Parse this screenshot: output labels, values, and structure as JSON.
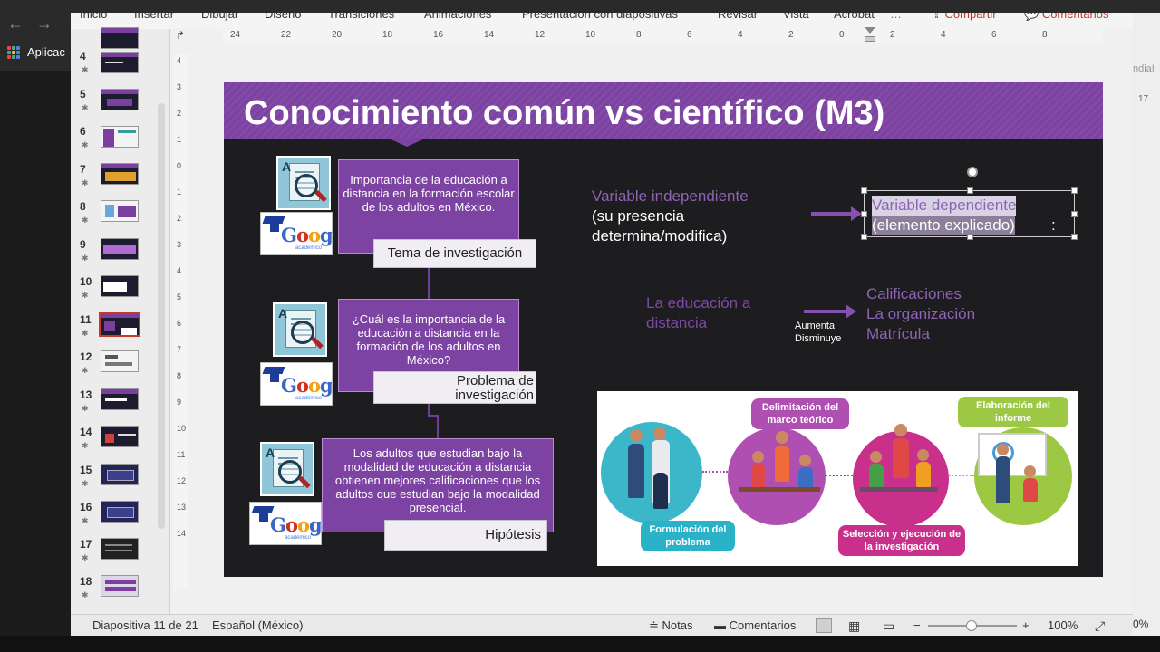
{
  "menubar": {
    "items": [
      "Inicio",
      "Insertar",
      "Dibujar",
      "Diseño",
      "Transiciones",
      "Animaciones",
      "Presentación con diapositivas",
      "Revisar",
      "Vista",
      "Acrobat"
    ],
    "share_label": "Compartir",
    "comments_label": "Comentarios",
    "more_label": "…"
  },
  "browser": {
    "apps_label": "Aplicac",
    "right_fragment": "ndiaI",
    "right_num": "17",
    "right_zoom": "0%"
  },
  "thumbnails": {
    "numbers": [
      "4",
      "5",
      "6",
      "7",
      "8",
      "9",
      "10",
      "11",
      "12",
      "13",
      "14",
      "15",
      "16",
      "17",
      "18"
    ],
    "selected": "11"
  },
  "ruler": {
    "h_ticks": [
      "24",
      "22",
      "20",
      "18",
      "16",
      "14",
      "12",
      "10",
      "8",
      "6",
      "4",
      "2",
      "0",
      "2",
      "4",
      "6",
      "8"
    ],
    "v_ticks": [
      "4",
      "3",
      "2",
      "1",
      "0",
      "1",
      "2",
      "3",
      "4",
      "5",
      "6",
      "7",
      "8",
      "9",
      "10",
      "11",
      "12",
      "13",
      "14"
    ]
  },
  "slide": {
    "title": "Conocimiento común vs científico (M3)",
    "box1": {
      "text": "Importancia de la educación a distancia en la formación escolar de los adultos en México.",
      "label": "Tema de investigación"
    },
    "box2": {
      "text": "¿Cuál es la importancia de la educación a distancia en la formación de los adultos en México?",
      "label": "Problema de investigación"
    },
    "box3": {
      "text": "Los adultos que estudian bajo la modalidad de educación a distancia obtienen mejores calificaciones que los adultos que estudian bajo la modalidad presencial.",
      "label": "Hipótesis"
    },
    "google": {
      "letters": [
        "G",
        "o",
        "o",
        "g",
        "l",
        "e"
      ],
      "sub": "académico"
    },
    "icon_letter": "A",
    "var_indep_title": "Variable independiente",
    "var_indep_desc1": "(su presencia",
    "var_indep_desc2": "determina/modifica)",
    "var_dep_line1": "Variable dependiente",
    "var_dep_line2": "(elemento explicado)",
    "var_dep_colon": ":",
    "example_left1": "La educación a",
    "example_left2": "distancia",
    "aumenta": "Aumenta",
    "disminuye": "Disminuye",
    "example_right": [
      "Calificaciones",
      "La organización",
      "Matrícula"
    ],
    "infographic": {
      "formulacion": "Formulación del problema",
      "delimitacion": "Delimitación del marco teórico",
      "seleccion": "Selección y ejecución de la investigación",
      "elaboracion": "Elaboración del informe"
    }
  },
  "status": {
    "slide_info": "Diapositiva 11 de 21",
    "language": "Español (México)",
    "notes": "Notas",
    "comments": "Comentarios",
    "zoom": "100%"
  },
  "colors": {
    "accent_purple": "#7d43a2",
    "selected_border": "#c43b2a"
  }
}
